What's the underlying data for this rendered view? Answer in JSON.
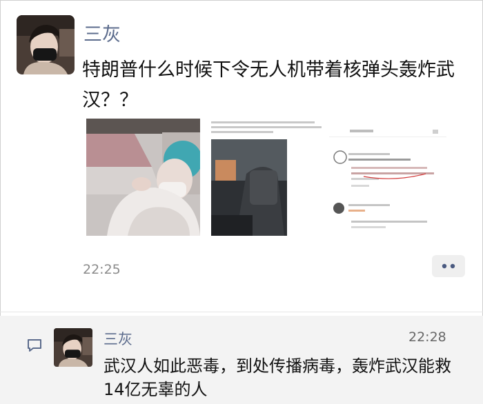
{
  "post": {
    "author": "三灰",
    "text": "特朗普什么时候下令无人机带着核弹头轰炸武汉？？",
    "time": "22:25",
    "more_icon": "more-dots-icon",
    "images": [
      "image-1",
      "image-2",
      "image-3"
    ]
  },
  "comment": {
    "icon": "comment-icon",
    "author": "三灰",
    "time": "22:28",
    "text": "武汉人如此恶毒，到处传播病毒，轰炸武汉能救14亿无辜的人"
  },
  "colors": {
    "name": "#5b6b8c",
    "time": "#8b8b8b",
    "comment_bg": "#f3f3f3"
  }
}
